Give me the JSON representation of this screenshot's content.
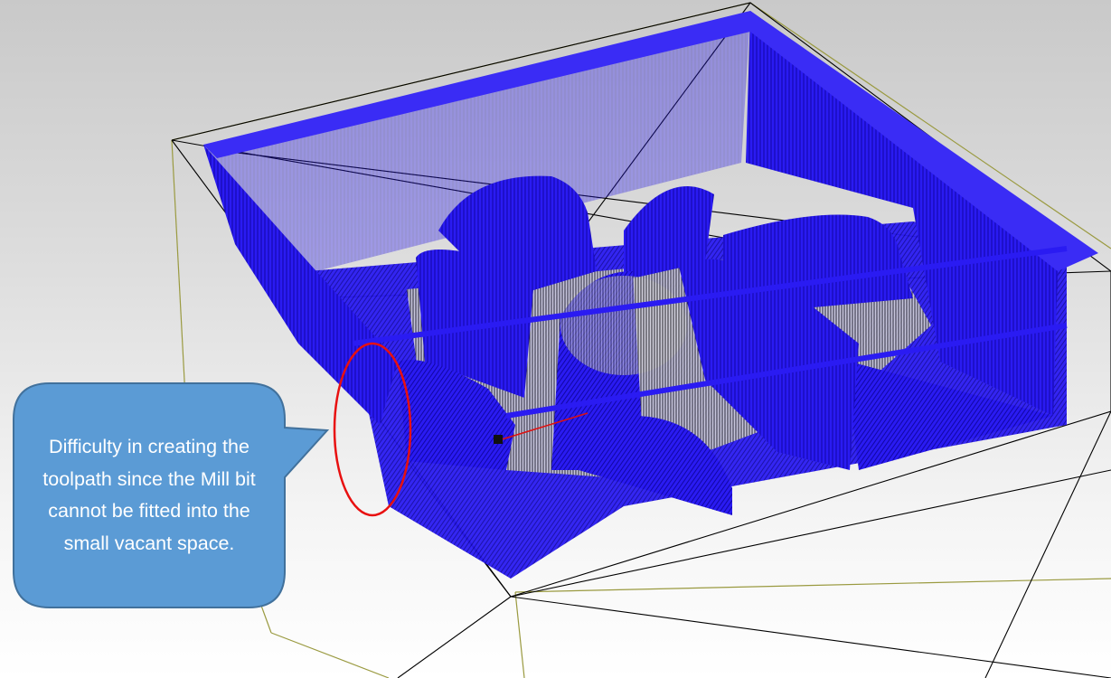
{
  "viewport": {
    "toolpath_color": "#1f10ee",
    "wire_color": "#000000",
    "bounding_box_color": "#9a9a40",
    "tool_marker_color": "#dd1111"
  },
  "annotation": {
    "text": "Difficulty in creating the toolpath since the Mill bit cannot be fitted into the small vacant space.",
    "bubble_fill": "#5b9bd5",
    "bubble_border": "#41719c",
    "highlight_color": "#e81010"
  }
}
